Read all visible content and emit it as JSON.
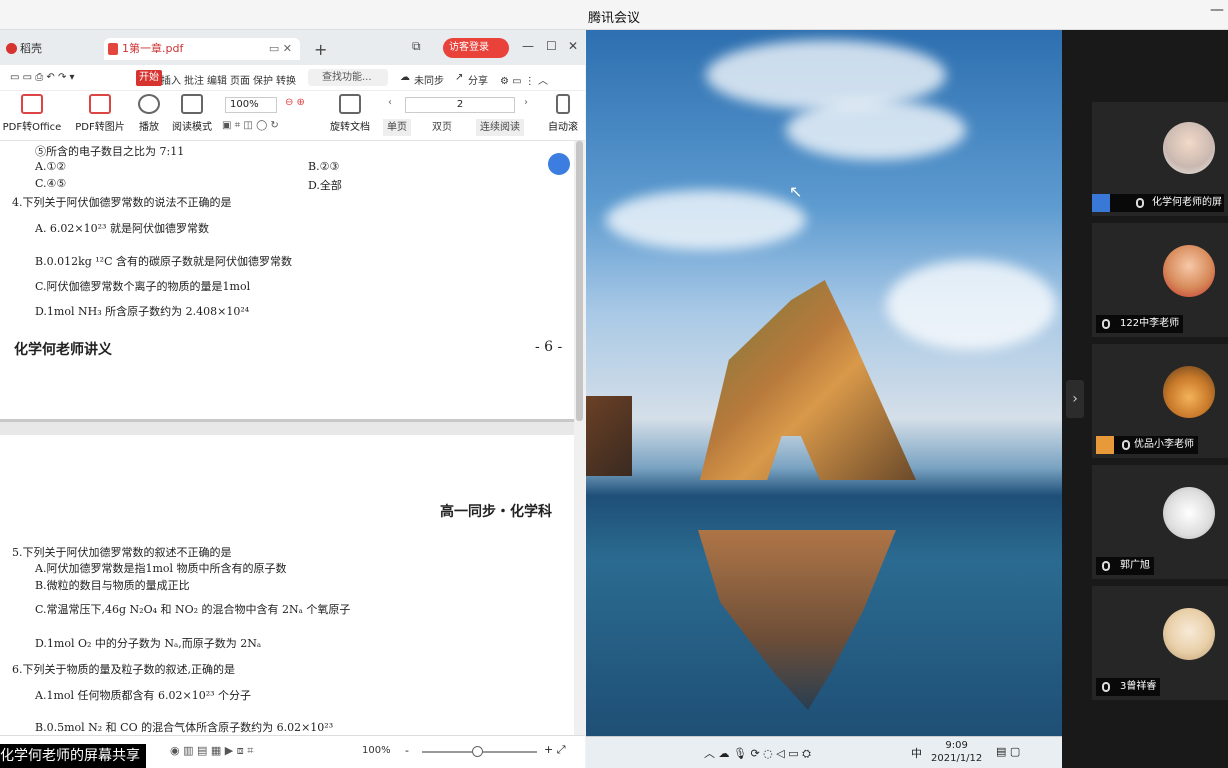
{
  "window_title": "腾讯会议",
  "wps": {
    "tabs": [
      {
        "label": "稻壳"
      },
      {
        "label": "1第一章.pdf"
      }
    ],
    "login_label": "访客登录",
    "menu": {
      "start": "开始",
      "items": [
        "插入",
        "批注",
        "编辑",
        "页面",
        "保护",
        "转换"
      ],
      "search": "查找功能...",
      "sync": "未同步",
      "share": "分享"
    },
    "toolbar": {
      "pdf_to_office": "PDF转Office",
      "pdf_to_image": "PDF转图片",
      "play": "播放",
      "read_mode": "阅读模式",
      "zoom": "100%",
      "rotate": "旋转文档",
      "page": "2",
      "single": "单页",
      "double": "双页",
      "continuous": "连续阅读",
      "auto": "自动滚"
    },
    "doc": {
      "lines_page1": [
        "⑤所含的电子数目之比为 7:11",
        "A.①②",
        "B.②③",
        "C.④⑤",
        "D.全部",
        "4.下列关于阿伏伽德罗常数的说法不正确的是",
        "A. 6.02×10²³ 就是阿伏伽德罗常数",
        "B.0.012kg ¹²C 含有的碳原子数就是阿伏伽德罗常数",
        "C.阿伏伽德罗常数个离子的物质的量是1mol",
        "D.1mol NH₃ 所含原子数约为 2.408×10²⁴"
      ],
      "footer_left": "化学何老师讲义",
      "footer_right": "- 6 -",
      "header_page2": "高一同步・化学科",
      "lines_page2": [
        "5.下列关于阿伏加德罗常数的叙述不正确的是",
        "A.阿伏加德罗常数是指1mol 物质中所含有的原子数",
        "B.微粒的数目与物质的量成正比",
        "C.常温常压下,46g N₂O₄ 和 NO₂ 的混合物中含有 2Nₐ 个氧原子",
        "D.1mol O₂ 中的分子数为 Nₐ,而原子数为 2Nₐ",
        "6.下列关于物质的量及粒子数的叙述,正确的是",
        "A.1mol 任何物质都含有 6.02×10²³ 个分子",
        "B.0.5mol N₂ 和 CO 的混合气体所含原子数约为 6.02×10²³"
      ]
    },
    "status_zoom": "100%"
  },
  "share_label": "化学何老师的屏幕共享",
  "taskbar": {
    "ime": "中",
    "time": "9:09",
    "date": "2021/1/12"
  },
  "participants": [
    {
      "name": "化学何老师的屏"
    },
    {
      "name": "122中李老师"
    },
    {
      "name": "优品小李老师"
    },
    {
      "name": "郭广旭"
    },
    {
      "name": "3曾祥睿"
    }
  ],
  "colors": {
    "accent": "#d7332f",
    "meeting_bg": "#191919"
  }
}
